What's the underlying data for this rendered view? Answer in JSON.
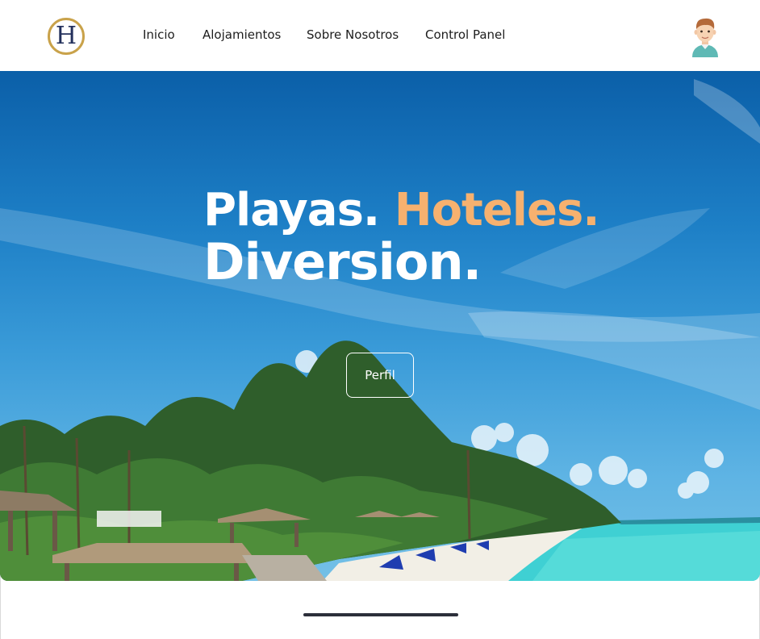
{
  "navbar": {
    "logo_letter": "H",
    "links": [
      "Inicio",
      "Alojamientos",
      "Sobre Nosotros",
      "Control Panel"
    ]
  },
  "hero": {
    "headline_part1": "Playas.",
    "headline_part2": "Hoteles.",
    "headline_part3": "Diversion.",
    "button_label": "Perfil"
  },
  "colors": {
    "accent": "#f6b16f",
    "logo_ring": "#c9a24a",
    "logo_letter": "#23305c"
  },
  "icons": {
    "avatar": "user-avatar-icon",
    "logo": "hotel-logo-icon"
  }
}
